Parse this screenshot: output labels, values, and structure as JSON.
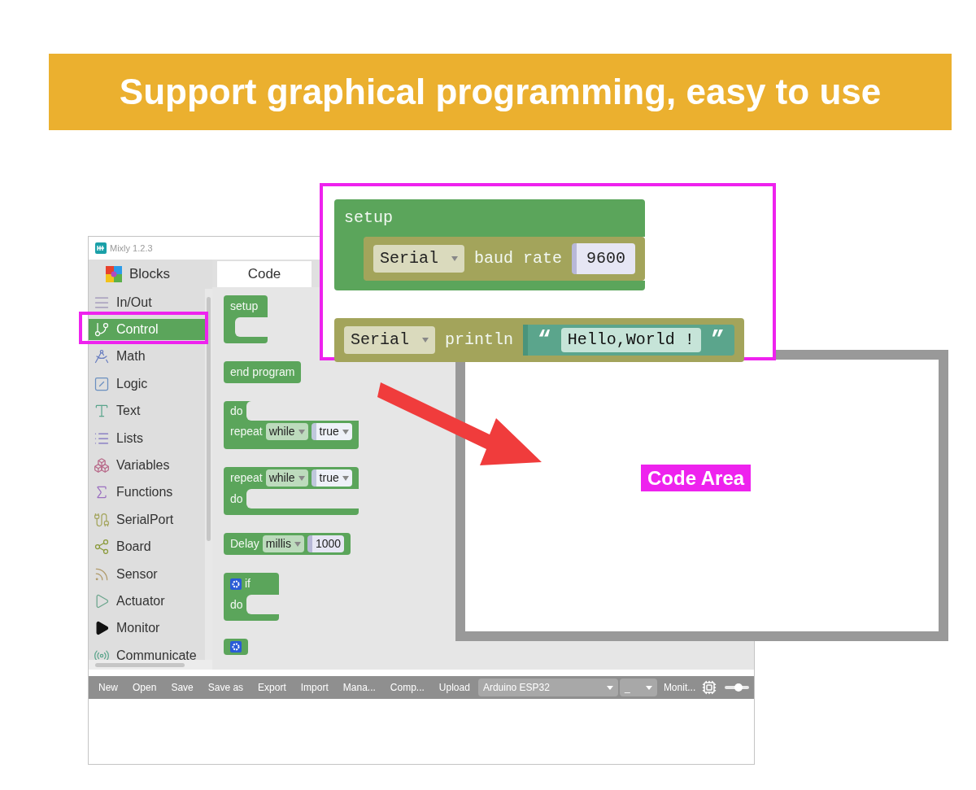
{
  "banner": {
    "title": "Support graphical programming, easy to use"
  },
  "window": {
    "title": "Mixly 1.2.3"
  },
  "sidebar": {
    "header": "Blocks",
    "items": [
      {
        "label": "In/Out",
        "selected": false
      },
      {
        "label": "Control",
        "selected": true
      },
      {
        "label": "Math",
        "selected": false
      },
      {
        "label": "Logic",
        "selected": false
      },
      {
        "label": "Text",
        "selected": false
      },
      {
        "label": "Lists",
        "selected": false
      },
      {
        "label": "Variables",
        "selected": false
      },
      {
        "label": "Functions",
        "selected": false
      },
      {
        "label": "SerialPort",
        "selected": false
      },
      {
        "label": "Board",
        "selected": false
      },
      {
        "label": "Sensor",
        "selected": false
      },
      {
        "label": "Actuator",
        "selected": false
      },
      {
        "label": "Monitor",
        "selected": false
      },
      {
        "label": "Communicate",
        "selected": false
      }
    ]
  },
  "tabs": [
    {
      "label": "Code",
      "selected": true
    }
  ],
  "flyout": [
    {
      "color": "#5ba55b",
      "lines": [
        {
          "kind": "row",
          "tokens": [
            {
              "kind": "label",
              "text": "setup"
            }
          ]
        },
        {
          "kind": "mouth"
        }
      ]
    },
    {
      "color": "#5ba55b",
      "lines": [
        {
          "kind": "row",
          "tokens": [
            {
              "kind": "label",
              "text": "end program"
            }
          ]
        }
      ]
    },
    {
      "color": "#5ba55b",
      "lines": [
        {
          "kind": "mouth",
          "tokens": [
            {
              "kind": "label",
              "text": "do"
            }
          ]
        },
        {
          "kind": "row",
          "tokens": [
            {
              "kind": "label",
              "text": "repeat"
            },
            {
              "kind": "dropdown",
              "text": "while"
            },
            {
              "kind": "value_dropdown",
              "text": "true"
            }
          ]
        }
      ]
    },
    {
      "color": "#5ba55b",
      "lines": [
        {
          "kind": "row",
          "tokens": [
            {
              "kind": "label",
              "text": "repeat"
            },
            {
              "kind": "dropdown",
              "text": "while"
            },
            {
              "kind": "value_dropdown",
              "text": "true"
            }
          ]
        },
        {
          "kind": "mouth",
          "tokens": [
            {
              "kind": "label",
              "text": "do"
            }
          ]
        }
      ]
    },
    {
      "color": "#5ba55b",
      "lines": [
        {
          "kind": "row",
          "tokens": [
            {
              "kind": "label",
              "text": "Delay"
            },
            {
              "kind": "dropdown",
              "text": "millis"
            },
            {
              "kind": "value",
              "text": "1000"
            }
          ]
        }
      ]
    },
    {
      "color": "#5ba55b",
      "lines": [
        {
          "kind": "row",
          "tokens": [
            {
              "kind": "gear"
            },
            {
              "kind": "label",
              "text": "if"
            }
          ]
        },
        {
          "kind": "mouth",
          "tokens": [
            {
              "kind": "label",
              "text": "do"
            }
          ]
        }
      ]
    },
    {
      "color": "#5ba55b",
      "lines": [
        {
          "kind": "row",
          "tokens": [
            {
              "kind": "gear"
            }
          ]
        }
      ]
    }
  ],
  "toolbar": {
    "buttons": [
      "New",
      "Open",
      "Save",
      "Save as",
      "Export",
      "Import",
      "Mana...",
      "Comp...",
      "Upload"
    ],
    "board_select": "Arduino ESP32",
    "port_select": "_",
    "monitor": "Monit..."
  },
  "callout": {
    "blocks": [
      {
        "color": "#5ba55b",
        "lines": [
          {
            "kind": "row",
            "tokens": [
              {
                "kind": "label",
                "text": "setup"
              }
            ]
          },
          {
            "kind": "mouth",
            "child": {
              "color": "#a3a45b",
              "lines": [
                {
                  "kind": "row",
                  "tokens": [
                    {
                      "kind": "dropdown",
                      "text": "Serial"
                    },
                    {
                      "kind": "label",
                      "text": "baud rate"
                    },
                    {
                      "kind": "value",
                      "text": "9600"
                    }
                  ]
                }
              ]
            }
          }
        ]
      },
      {
        "color": "#a3a45b",
        "lines": [
          {
            "kind": "row",
            "tokens": [
              {
                "kind": "dropdown",
                "text": "Serial"
              },
              {
                "kind": "label",
                "text": "println"
              },
              {
                "kind": "text_block",
                "open": "“",
                "text": "Hello,World !",
                "close": "”"
              }
            ]
          }
        ]
      }
    ]
  },
  "code_area": {
    "label": "Code Area"
  }
}
